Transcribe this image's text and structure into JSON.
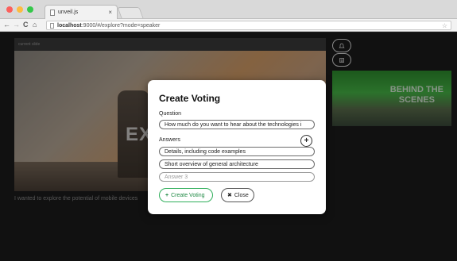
{
  "browser": {
    "tab_title": "unveil.js",
    "tab_close": "×",
    "url_host": "localhost",
    "url_rest": ":9000/#/explore?mode=speaker",
    "nav_back": "←",
    "nav_forward": "→",
    "nav_reload": "C",
    "nav_home": "⌂",
    "star": "☆",
    "light_colors": [
      "#fc605c",
      "#fdbc40",
      "#34c84a"
    ]
  },
  "page": {
    "current_slide_label": "current slide",
    "slide_title_fragment": "EX",
    "slide_text": "I wanted to explore the potential of mobile devices",
    "next_slide_title_line1": "BEHIND THE",
    "next_slide_title_line2": "SCENES"
  },
  "modal": {
    "title": "Create Voting",
    "question_label": "Question",
    "question_value": "How much do you want to hear about the technologies i",
    "answers_label": "Answers",
    "add_answer_symbol": "+",
    "answers": [
      "Details, including code examples",
      "Short overview of general architecture"
    ],
    "answer3_placeholder": "Answer 3",
    "create_button_icon": "+",
    "create_button_label": "Create Voting",
    "close_button_icon": "✖",
    "close_button_label": "Close",
    "accent_color": "#2fae5a"
  }
}
